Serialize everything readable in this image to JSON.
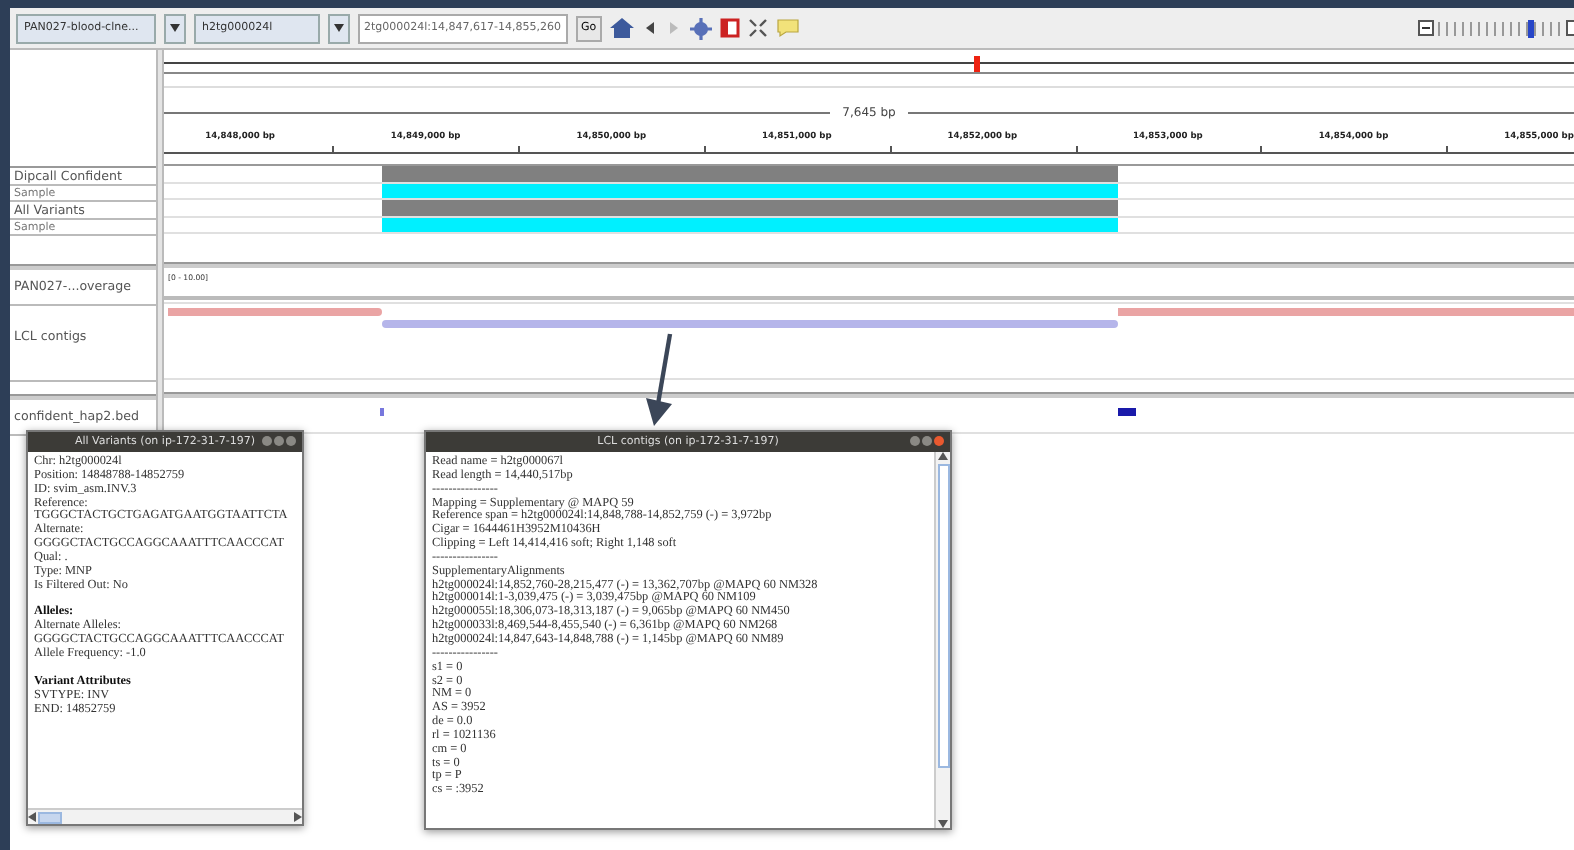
{
  "toolbar": {
    "genome": "PAN027-blood-clne...",
    "chromosome": "h2tg000024l",
    "locus": "2tg000024l:14,847,617-14,855,260",
    "go": "Go",
    "zoom": {
      "level": 0.72
    }
  },
  "ruler": {
    "span": "7,645 bp",
    "ticks": [
      "14,848,000 bp",
      "14,849,000 bp",
      "14,850,000 bp",
      "14,851,000 bp",
      "14,852,000 bp",
      "14,853,000 bp",
      "14,854,000 bp",
      "14,855,000 bp"
    ]
  },
  "tracks": [
    {
      "name": "Dipcall Confident",
      "kind": "variant"
    },
    {
      "name": "Sample",
      "kind": "genotype"
    },
    {
      "name": "All Variants",
      "kind": "variant"
    },
    {
      "name": "Sample",
      "kind": "genotype"
    },
    {
      "name": "PAN027-...overage",
      "kind": "coverage",
      "range": "[0 - 10.00]"
    },
    {
      "name": "LCL contigs",
      "kind": "alignment"
    },
    {
      "name": "confident_hap2.bed",
      "kind": "bed"
    }
  ],
  "popups": [
    {
      "title": "All Variants (on ip-172-31-7-197)",
      "kind": "variant",
      "lines": [
        {
          "text": "Chr: h2tg000024l",
          "kind": "plain"
        },
        {
          "text": "Position: 14848788-14852759",
          "kind": "plain"
        },
        {
          "text": "ID: svim_asm.INV.3",
          "kind": "plain"
        },
        {
          "text": "Reference:",
          "kind": "plain"
        },
        {
          "text": "TGGGCTACTGCTGAGATGAATGGTAATTCTA",
          "kind": "plain"
        },
        {
          "text": "Alternate:",
          "kind": "plain"
        },
        {
          "text": "GGGGCTACTGCCAGGCAAATTTCAACCCAT",
          "kind": "plain"
        },
        {
          "text": "Qual: .",
          "kind": "plain"
        },
        {
          "text": "Type: MNP",
          "kind": "plain"
        },
        {
          "text": "Is Filtered Out: No",
          "kind": "plain"
        },
        {
          "text": "Alleles:",
          "kind": "heading"
        },
        {
          "text": "Alternate Alleles:",
          "kind": "plain"
        },
        {
          "text": "GGGGCTACTGCCAGGCAAATTTCAACCCAT",
          "kind": "plain"
        },
        {
          "text": "Allele Frequency: -1.0",
          "kind": "plain"
        },
        {
          "text": "Variant Attributes",
          "kind": "heading"
        },
        {
          "text": "SVTYPE: INV",
          "kind": "plain"
        },
        {
          "text": "END: 14852759",
          "kind": "plain"
        }
      ]
    },
    {
      "title": "LCL contigs (on ip-172-31-7-197)",
      "kind": "alignment",
      "lines": [
        {
          "text": "Read name = h2tg000067l",
          "kind": "plain"
        },
        {
          "text": "Read length = 14,440,517bp",
          "kind": "plain"
        },
        {
          "text": "----------------",
          "kind": "plain"
        },
        {
          "text": "Mapping = Supplementary @ MAPQ 59",
          "kind": "plain"
        },
        {
          "text": "Reference span = h2tg000024l:14,848,788-14,852,759 (-) = 3,972bp",
          "kind": "plain"
        },
        {
          "text": "Cigar = 1644461H3952M10436H",
          "kind": "plain"
        },
        {
          "text": "Clipping = Left 14,414,416 soft; Right 1,148 soft",
          "kind": "plain"
        },
        {
          "text": "----------------",
          "kind": "plain"
        },
        {
          "text": "SupplementaryAlignments",
          "kind": "plain"
        },
        {
          "text": "h2tg000024l:14,852,760-28,215,477 (-) = 13,362,707bp @MAPQ 60 NM328",
          "kind": "plain"
        },
        {
          "text": "h2tg000014l:1-3,039,475 (-) = 3,039,475bp @MAPQ 60 NM109",
          "kind": "plain"
        },
        {
          "text": "h2tg000055l:18,306,073-18,313,187 (-) = 9,065bp @MAPQ 60 NM450",
          "kind": "plain"
        },
        {
          "text": "h2tg000033l:8,469,544-8,455,540 (-) = 6,361bp @MAPQ 60 NM268",
          "kind": "plain"
        },
        {
          "text": "h2tg000024l:14,847,643-14,848,788 (-) = 1,145bp @MAPQ 60 NM89",
          "kind": "plain"
        },
        {
          "text": "----------------",
          "kind": "plain"
        },
        {
          "text": "s1 = 0",
          "kind": "plain"
        },
        {
          "text": "s2 = 0",
          "kind": "plain"
        },
        {
          "text": "NM = 0",
          "kind": "plain"
        },
        {
          "text": "AS = 3952",
          "kind": "plain"
        },
        {
          "text": "de = 0.0",
          "kind": "plain"
        },
        {
          "text": "rl = 1021136",
          "kind": "plain"
        },
        {
          "text": "cm = 0",
          "kind": "plain"
        },
        {
          "text": "ts = 0",
          "kind": "plain"
        },
        {
          "text": "tp = P",
          "kind": "plain"
        },
        {
          "text": "cs = :3952",
          "kind": "plain"
        }
      ]
    }
  ]
}
